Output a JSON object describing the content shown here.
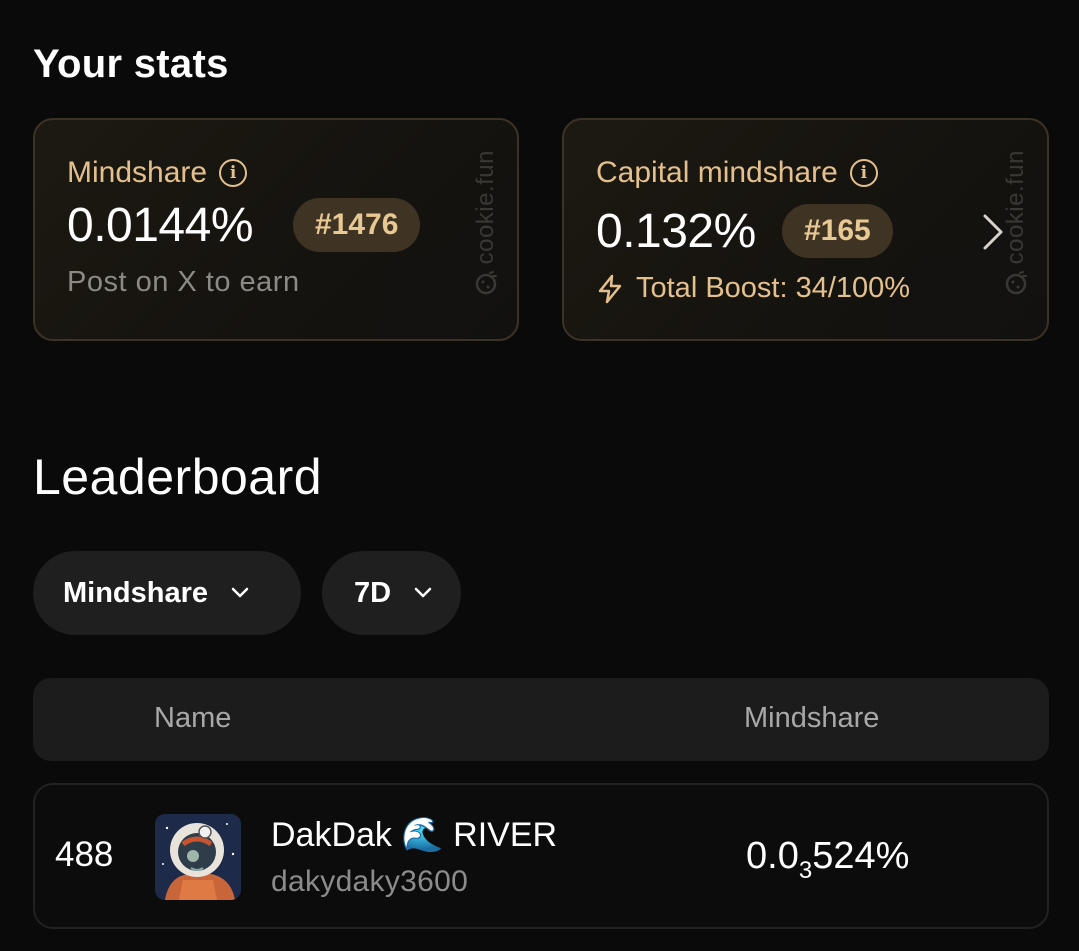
{
  "stats": {
    "title": "Your stats",
    "mindshare_card": {
      "label": "Mindshare",
      "value": "0.0144%",
      "rank": "#1476",
      "subtext": "Post on X to earn",
      "watermark": "cookie.fun"
    },
    "capital_card": {
      "label": "Capital mindshare",
      "value": "0.132%",
      "rank": "#165",
      "boost_text": "Total Boost: 34/100%",
      "watermark": "cookie.fun"
    }
  },
  "leaderboard": {
    "title": "Leaderboard",
    "metric_filter": "Mindshare",
    "period_filter": "7D",
    "columns": {
      "name": "Name",
      "mindshare": "Mindshare"
    },
    "rows": [
      {
        "rank": "488",
        "display_name": "DakDak 🌊 RIVER",
        "handle": "dakydaky3600",
        "value_prefix": "0.0",
        "value_zeros": "3",
        "value_suffix": "524%"
      }
    ]
  },
  "colors": {
    "accent_gold": "#e3c08d",
    "pill_bg": "#3f3424",
    "card_border": "#3b3325",
    "background": "#0a0a0a"
  },
  "icons": [
    "info-icon",
    "lightning-icon",
    "chevron-right-icon",
    "chevron-down-icon",
    "cookie-logo-icon"
  ]
}
